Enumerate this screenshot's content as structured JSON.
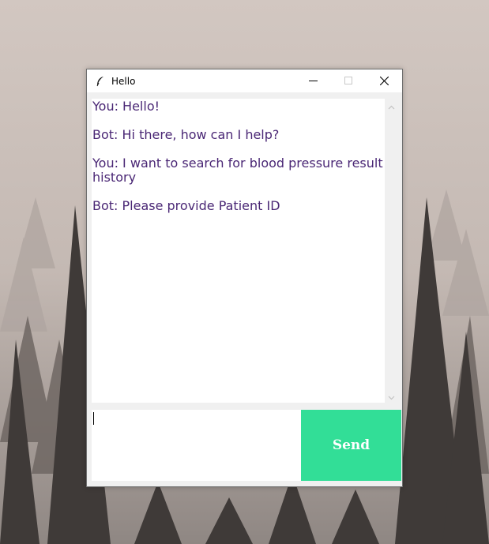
{
  "window": {
    "title": "Hello",
    "title_icon": "feather-icon",
    "controls": [
      "minimize-icon",
      "maximize-icon",
      "close-icon"
    ]
  },
  "chat": {
    "messages": [
      "You: Hello!",
      "Bot: Hi there, how can I help?",
      "You: I want to search for blood pressure result history",
      "Bot: Please provide Patient ID"
    ],
    "text_color": "#4a2775"
  },
  "input": {
    "value": ""
  },
  "send_button": {
    "label": "Send",
    "color": "#32de97",
    "text_color": "#ffffff"
  }
}
